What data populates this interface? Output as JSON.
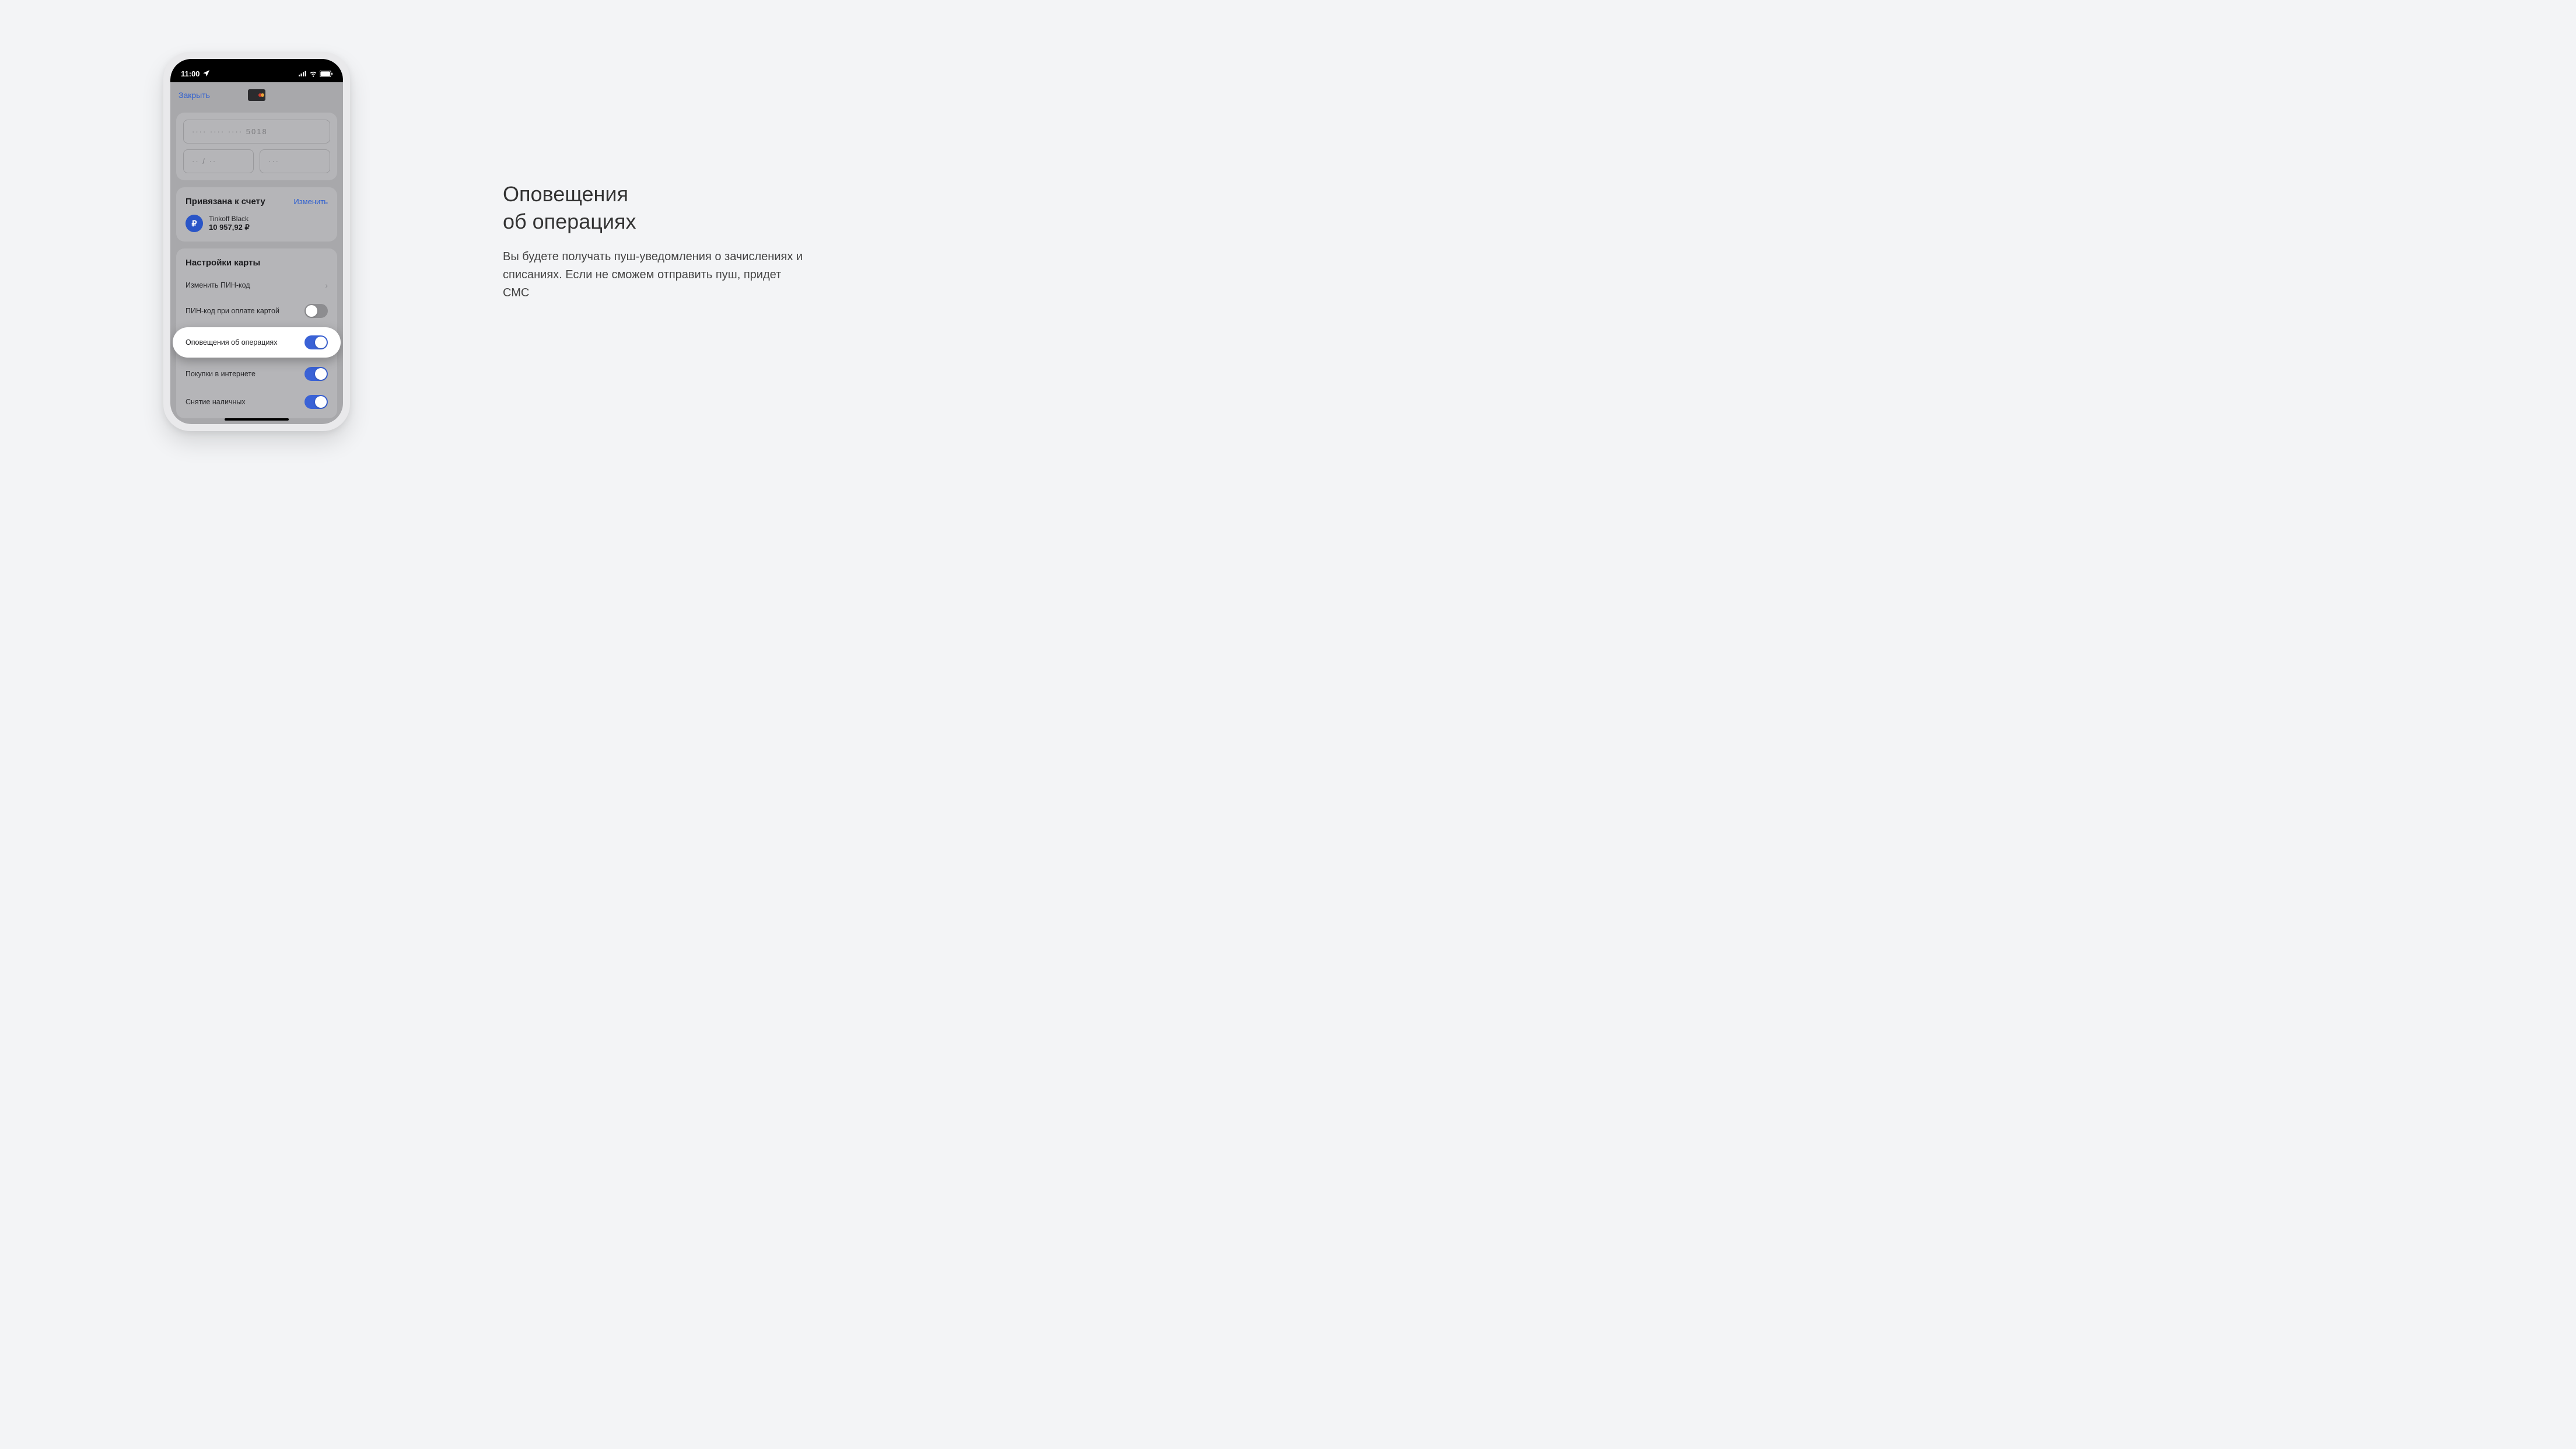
{
  "statusBar": {
    "time": "11:00"
  },
  "header": {
    "close": "Закрыть"
  },
  "cardPan": {
    "number": "····  ····  ···· 5018",
    "expiry": "·· / ··",
    "cvv": "···"
  },
  "linked": {
    "title": "Привязана к счету",
    "change": "Изменить",
    "account": {
      "name": "Tinkoff Black",
      "balance": "10 957,92 ₽",
      "currencySymbol": "₽"
    }
  },
  "settings": {
    "title": "Настройки карты",
    "rows": {
      "changePin": "Изменить ПИН-код",
      "pinOnPay": "ПИН-код при оплате картой",
      "notifications": "Оповещения об операциях",
      "online": "Покупки в интернете",
      "cash": "Снятие наличных"
    }
  },
  "info": {
    "titleLine1": "Оповещения",
    "titleLine2": "об операциях",
    "body": "Вы будете получать пуш-уведомления о зачислениях и списаниях. Если не сможем отправить пуш, придет СМС"
  }
}
